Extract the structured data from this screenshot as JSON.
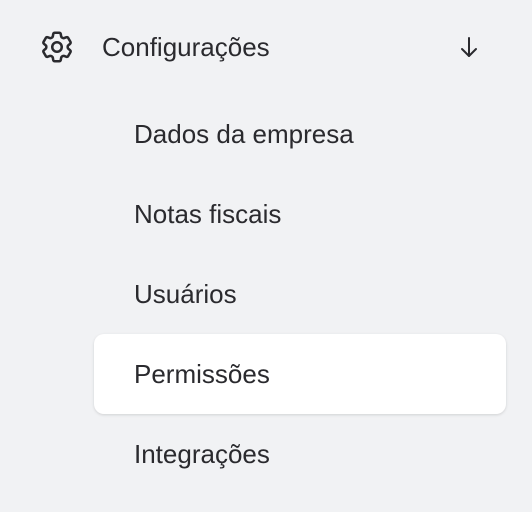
{
  "sidebar": {
    "section": {
      "title": "Configurações",
      "icon": "gear-icon",
      "toggle_icon": "arrow-down-icon",
      "expanded": true
    },
    "items": [
      {
        "label": "Dados da empresa",
        "active": false
      },
      {
        "label": "Notas fiscais",
        "active": false
      },
      {
        "label": "Usuários",
        "active": false
      },
      {
        "label": "Permissões",
        "active": true
      },
      {
        "label": "Integrações",
        "active": false
      }
    ]
  },
  "colors": {
    "background": "#f1f2f4",
    "active_item_background": "#ffffff",
    "text": "#2a2a2e"
  }
}
